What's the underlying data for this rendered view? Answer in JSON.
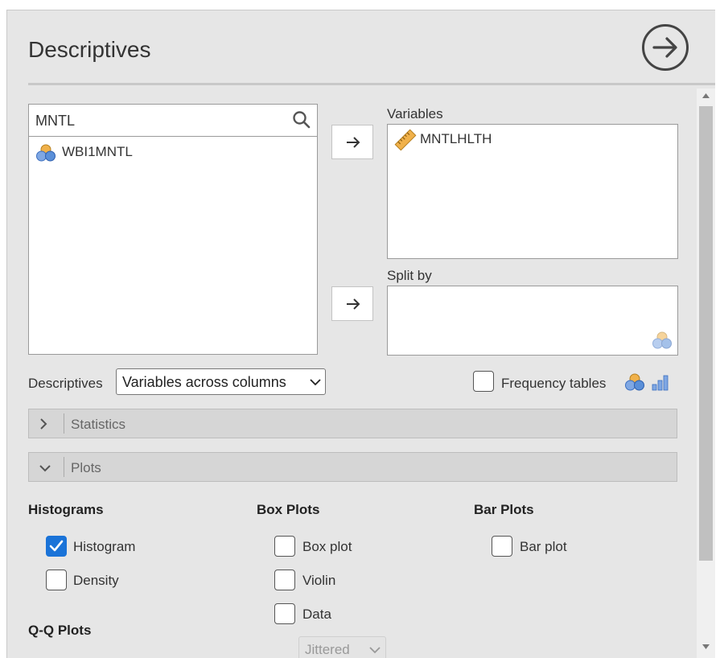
{
  "header": {
    "title": "Descriptives"
  },
  "variable_search": {
    "query": "MNTL"
  },
  "source_variables": [
    {
      "label": "WBI1MNTL",
      "type": "nominal"
    }
  ],
  "variables_box": {
    "label": "Variables",
    "items": [
      {
        "label": "MNTLHLTH",
        "type": "continuous"
      }
    ]
  },
  "split_by_box": {
    "label": "Split by"
  },
  "layout_option": {
    "label": "Descriptives",
    "value": "Variables across columns"
  },
  "frequency_tables": {
    "label": "Frequency tables",
    "checked": false
  },
  "sections": [
    {
      "label": "Statistics",
      "expanded": false
    },
    {
      "label": "Plots",
      "expanded": true
    }
  ],
  "plots": {
    "histograms": {
      "heading": "Histograms",
      "options": [
        {
          "label": "Histogram",
          "checked": true
        },
        {
          "label": "Density",
          "checked": false
        }
      ]
    },
    "box_plots": {
      "heading": "Box Plots",
      "options": [
        {
          "label": "Box plot",
          "checked": false
        },
        {
          "label": "Violin",
          "checked": false
        },
        {
          "label": "Data",
          "checked": false
        }
      ],
      "data_style": "Jittered"
    },
    "bar_plots": {
      "heading": "Bar Plots",
      "options": [
        {
          "label": "Bar plot",
          "checked": false
        }
      ]
    },
    "qq_plots": {
      "heading": "Q-Q Plots"
    }
  },
  "colors": {
    "checkbox_checked": "#1a73d8",
    "panel_bg": "#e6e6e6",
    "nominal_icon_orange": "#f0b14a",
    "nominal_icon_blue": "#5a8fd8",
    "ruler_icon": "#e8a93a"
  }
}
